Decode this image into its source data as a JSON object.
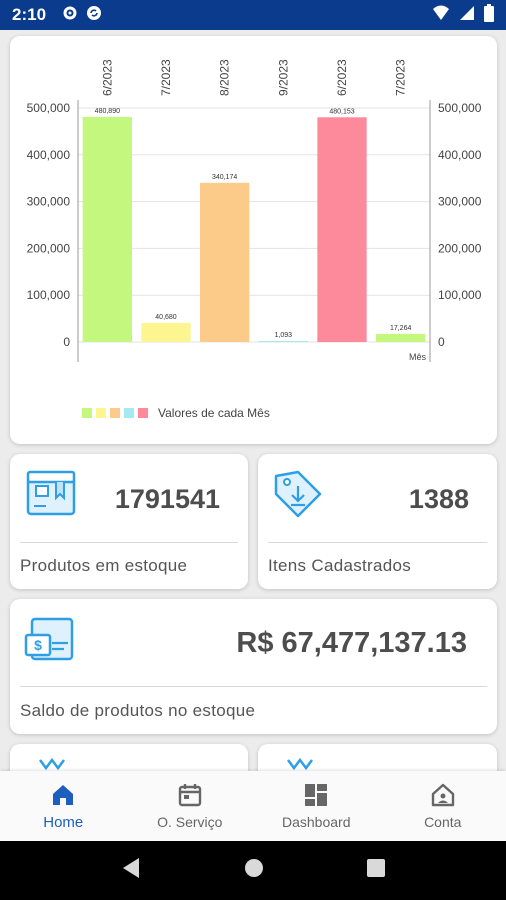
{
  "status_bar": {
    "time": "2:10"
  },
  "chart_data": {
    "type": "bar",
    "categories": [
      "6/2023",
      "7/2023",
      "8/2023",
      "9/2023",
      "6/2023",
      "7/2023"
    ],
    "values": [
      480890,
      40680,
      340174,
      1093,
      480153,
      17264
    ],
    "value_labels": [
      "480,890",
      "40,680",
      "340,174",
      "1,093",
      "480,153",
      "17,264"
    ],
    "colors": [
      "#c3f77d",
      "#fdf58f",
      "#fccb8a",
      "#a6e9f0",
      "#fc8a9a",
      "#c3f77d"
    ],
    "ylim": [
      0,
      500000
    ],
    "yticks": [
      "0",
      "100,000",
      "200,000",
      "300,000",
      "400,000",
      "500,000"
    ],
    "xlabel": "Mês",
    "legend": {
      "label": "Valores de cada Mês",
      "swatch_colors": [
        "#c3f77d",
        "#fdf58f",
        "#fccb8a",
        "#a6e9f0",
        "#fc8a9a"
      ]
    },
    "grid": true
  },
  "stats": {
    "stock": {
      "value": "1791541",
      "label": "Produtos em estoque"
    },
    "items": {
      "value": "1388",
      "label": "Itens Cadastrados"
    },
    "balance": {
      "value": "R$ 67,477,137.13",
      "label": "Saldo de produtos no estoque"
    }
  },
  "nav": {
    "items": [
      {
        "label": "Home",
        "icon": "home-icon",
        "active": true
      },
      {
        "label": "O. Serviço",
        "icon": "calendar-icon",
        "active": false
      },
      {
        "label": "Dashboard",
        "icon": "dashboard-icon",
        "active": false
      },
      {
        "label": "Conta",
        "icon": "account-icon",
        "active": false
      }
    ]
  },
  "colors": {
    "status_bar": "#0b3b8c",
    "accent": "#1d5fbf",
    "icon_blue": "#2e9fe6"
  }
}
